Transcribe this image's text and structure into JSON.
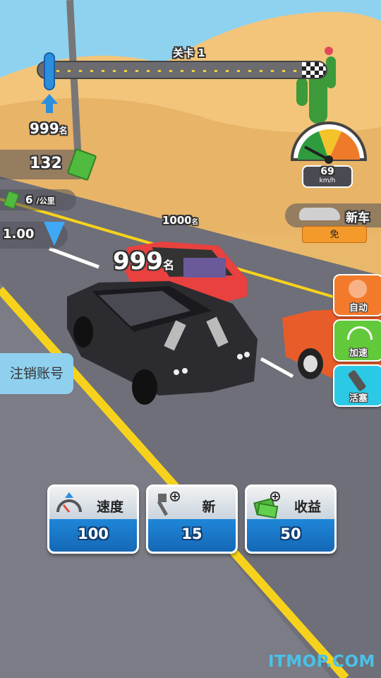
{
  "level": {
    "label": "关卡 1",
    "progress": 0.05
  },
  "rank": {
    "value": "999",
    "unit": "名"
  },
  "money": {
    "value": "132"
  },
  "earning": {
    "value": "6",
    "unit": "/公里"
  },
  "gems": {
    "value": "1.00"
  },
  "speedometer": {
    "value": "69",
    "unit": "km/h"
  },
  "new_car": {
    "label": "新车",
    "price": "免"
  },
  "rivals": [
    {
      "value": "1000",
      "unit": "名"
    },
    {
      "value": "999",
      "unit": "名"
    }
  ],
  "side_buttons": [
    {
      "label": "自动",
      "color": "#f47a2b",
      "icon": "hand-tap-icon"
    },
    {
      "label": "加速",
      "color": "#62c93a",
      "icon": "speedometer-icon"
    },
    {
      "label": "活塞",
      "color": "#2cc9e6",
      "icon": "piston-icon"
    }
  ],
  "logout": {
    "label": "注销账号"
  },
  "upgrades": [
    {
      "label": "速度",
      "value": "100",
      "icon": "speedometer-icon"
    },
    {
      "label": "新",
      "value": "15",
      "icon": "piston-icon"
    },
    {
      "label": "收益",
      "value": "50",
      "icon": "cash-icon"
    }
  ],
  "watermark": "ITMOP.COM",
  "colors": {
    "road": "#6e6f78",
    "sand": "#e9b86a",
    "sky": "#8fd2f0",
    "line": "#f7d21c"
  }
}
